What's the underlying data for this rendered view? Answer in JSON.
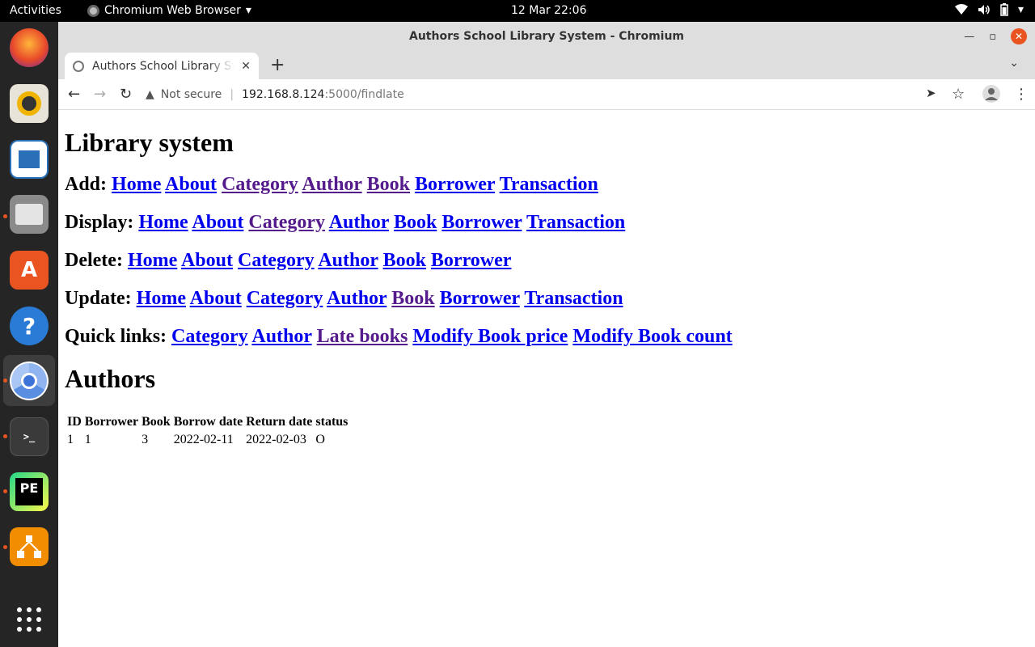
{
  "topbar": {
    "activities": "Activities",
    "app_name": "Chromium Web Browser",
    "clock": "12 Mar  22:06"
  },
  "dock": {
    "items": [
      "firefox-icon",
      "rhythmbox-icon",
      "libreoffice-writer-icon",
      "files-icon",
      "software-icon",
      "help-icon",
      "chromium-icon",
      "terminal-icon",
      "pycharm-icon",
      "dia-icon",
      "show-apps-icon"
    ]
  },
  "window": {
    "title": "Authors School Library System - Chromium"
  },
  "tab": {
    "title": "Authors School Library Sy"
  },
  "omnibox": {
    "security": "Not secure",
    "host": "192.168.8.124",
    "path": ":5000/findlate"
  },
  "page": {
    "heading": "Library system",
    "nav": [
      {
        "label": "Add:",
        "links": [
          {
            "text": "Home",
            "visited": false
          },
          {
            "text": "About",
            "visited": false
          },
          {
            "text": "Category",
            "visited": true
          },
          {
            "text": "Author",
            "visited": true
          },
          {
            "text": "Book",
            "visited": true
          },
          {
            "text": "Borrower",
            "visited": false
          },
          {
            "text": "Transaction",
            "visited": false
          }
        ]
      },
      {
        "label": "Display:",
        "links": [
          {
            "text": "Home",
            "visited": false
          },
          {
            "text": "About",
            "visited": false
          },
          {
            "text": "Category",
            "visited": true
          },
          {
            "text": "Author",
            "visited": false
          },
          {
            "text": "Book",
            "visited": false
          },
          {
            "text": "Borrower",
            "visited": false
          },
          {
            "text": "Transaction",
            "visited": false
          }
        ]
      },
      {
        "label": "Delete:",
        "links": [
          {
            "text": "Home",
            "visited": false
          },
          {
            "text": "About",
            "visited": false
          },
          {
            "text": "Category",
            "visited": false
          },
          {
            "text": "Author",
            "visited": false
          },
          {
            "text": "Book",
            "visited": false
          },
          {
            "text": "Borrower",
            "visited": false
          }
        ]
      },
      {
        "label": "Update:",
        "links": [
          {
            "text": "Home",
            "visited": false
          },
          {
            "text": "About",
            "visited": false
          },
          {
            "text": "Category",
            "visited": false
          },
          {
            "text": "Author",
            "visited": false
          },
          {
            "text": "Book",
            "visited": true
          },
          {
            "text": "Borrower",
            "visited": false
          },
          {
            "text": "Transaction",
            "visited": false
          }
        ]
      },
      {
        "label": "Quick links:",
        "links": [
          {
            "text": "Category",
            "visited": false
          },
          {
            "text": "Author",
            "visited": false
          },
          {
            "text": "Late books",
            "visited": true
          },
          {
            "text": "Modify Book price",
            "visited": false
          },
          {
            "text": "Modify Book count",
            "visited": false
          }
        ]
      }
    ],
    "section_title": "Authors",
    "table": {
      "headers": [
        "ID",
        "Borrower",
        "Book",
        "Borrow date",
        "Return date",
        "status"
      ],
      "rows": [
        [
          "1",
          "1",
          "3",
          "2022-02-11",
          "2022-02-03",
          "O"
        ]
      ]
    }
  },
  "colors": {
    "link": "#0000ee",
    "visited": "#551a8b",
    "ubuntu_orange": "#e95420"
  }
}
